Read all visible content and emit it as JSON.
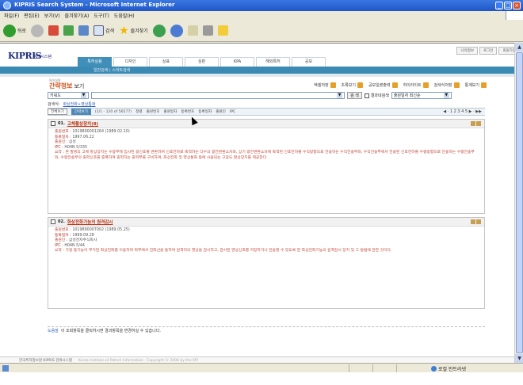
{
  "window": {
    "title": "KIPRIS Search System - Microsoft Internet Explorer"
  },
  "menubar": {
    "items": [
      "파일(F)",
      "편집(E)",
      "보기(V)",
      "즐겨찾기(A)",
      "도구(T)",
      "도움말(H)"
    ]
  },
  "toolbar": {
    "back_label": "뒤로",
    "search_label": "검색",
    "favorites_label": "즐겨찾기"
  },
  "site": {
    "logo": "KIPRIS",
    "logo_sub": "검색시스템",
    "util": [
      "나의정보",
      "로그인",
      "회원가입"
    ],
    "nav": [
      "특허실용",
      "디자인",
      "상표",
      "심판",
      "KPA",
      "해외특허",
      "공보"
    ],
    "subnav": "일반검색 | 스마트검색"
  },
  "main": {
    "head_small": "특허실용",
    "head_title": "간략정보",
    "head_title2": "보기",
    "actions": [
      "엑셀저장",
      "초록보기",
      "공보일괄출력",
      "하이라이트",
      "검색식저장",
      "통계보기"
    ],
    "field_select": "키워드",
    "search_button": "검 색",
    "within_label": "결과내검색",
    "sort_select": "출원일자 최신순",
    "expr_label": "검색식:",
    "expr_link": "화상전화+영상통화",
    "tab_all": "전체보기",
    "tab_brief": "간략보기",
    "count": "(1/1 - 120 of 56577)",
    "sort_links": [
      "정렬",
      "출원번호",
      "출원일자",
      "등록번호",
      "등록일자",
      "출원인",
      "IPC"
    ],
    "pager": "◀ · 1 2 3 4 5 ▶ · ▶▶"
  },
  "results": [
    {
      "num": "01.",
      "title": "고체촬상장치(8)",
      "fields": [
        {
          "label": "출원번호",
          "value": "1019890001264 (1989.02.10)"
        },
        {
          "label": "등록일자",
          "value": "1997.06.22"
        },
        {
          "label": "출원인",
          "value": "삼성"
        },
        {
          "label": "IPC",
          "value": "H04N 5/335"
        }
      ],
      "abstract_label": "요약",
      "abstract": "본 발명의 고체 촬상장치는 수광부에 입사된 광신호를 변환하여 신호전하로 축적하는 다수의 광전변환소자와, 상기 광전변환소자에 축적된 신호전하를 수직방향으로 전송하는 수직전송부와, 수직전송부에서 전송된 신호전하를 수평방향으로 전송하는 수평전송부와, 수평전송부의 출력신호를 증폭하여 출력하는 출력부를 구비하며, 화상전화 및 영상통화 등에 사용되는 고감도 촬상장치를 제공한다."
    },
    {
      "num": "02.",
      "title": "화상전화기능의 원격감시",
      "fields": [
        {
          "label": "출원번호",
          "value": "1019890007002 (1989.05.25)"
        },
        {
          "label": "등록일자",
          "value": "1999.09.28"
        },
        {
          "label": "출원인",
          "value": "삼성전자주식회사"
        },
        {
          "label": "IPC",
          "value": "H04N 5/44"
        }
      ],
      "abstract_label": "요약",
      "abstract": "가정 등기능이 부가된 화상전화를 이용하여 외부에서 전화선을 통하여 원격지의 영상을 감시하고, 감시된 영상신호를 저장하거나 전송할 수 있도록 한 화상전화기능의 원격감시 장치 및 그 방법에 관한 것이다."
    }
  ],
  "notice": {
    "tag": "도움말",
    "text": "이 조회항목을 클릭하시면 결과항목을 변경하실 수 있습니다."
  },
  "footer": {
    "left": "한국특허정보원 KIPRIS 검색시스템",
    "right": "Korea Institute of Patent Information · Copyright © 2006 by the KPI"
  },
  "statusbar": {
    "zone": "로컬 인트라넷"
  },
  "colors": {
    "nav_active": "#3f8fb8",
    "title_accent": "#d0501a",
    "title_bar": "#1f56c8"
  }
}
